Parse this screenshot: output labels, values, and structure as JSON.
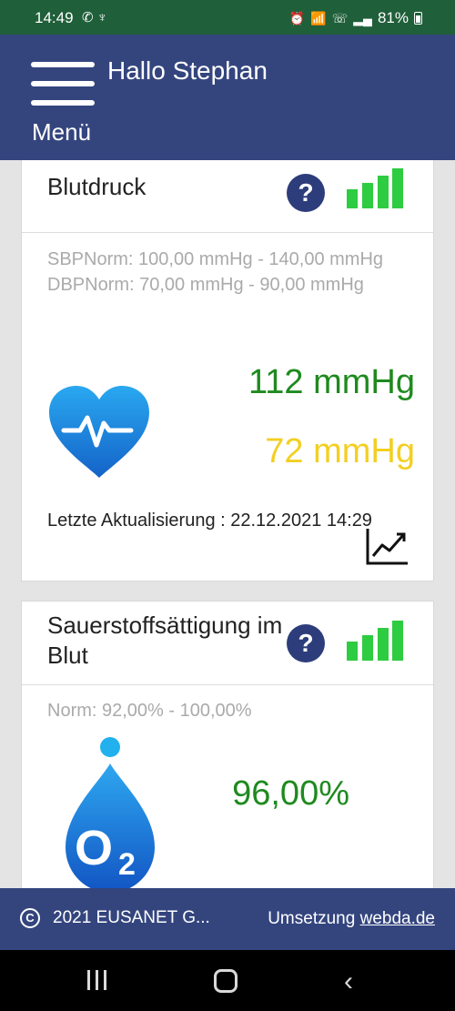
{
  "status_bar": {
    "time": "14:49",
    "left_icons": [
      "whatsapp-icon",
      "app-icon"
    ],
    "right_icons": [
      "alarm-icon",
      "wifi-icon",
      "wifi-call-icon",
      "signal-icon"
    ],
    "battery": "81%"
  },
  "header": {
    "greeting": "Hallo Stephan",
    "menu_label": "Menü"
  },
  "cards": {
    "blood_pressure": {
      "title": "Blutdruck",
      "help_label": "?",
      "norm_line1": "SBPNorm: 100,00 mmHg - 140,00 mmHg",
      "norm_line2": "DBPNorm: 70,00 mmHg - 90,00 mmHg",
      "systolic": "112 mmHg",
      "diastolic": "72 mmHg",
      "updated": "Letzte Aktualisierung : 22.12.2021 14:29",
      "signal_level": 4
    },
    "oxygen": {
      "title": "Sauerstoffsättigung im Blut",
      "help_label": "?",
      "norm": "Norm: 92,00% - 100,00%",
      "value": "96,00%",
      "drop_label": "O",
      "drop_subscript": "2",
      "signal_level": 4
    }
  },
  "footer": {
    "copyright_symbol": "C",
    "copyright_text": "2021 EUSANET G...",
    "implementation_prefix": "Umsetzung",
    "implementation_link": "webda.de"
  },
  "colors": {
    "header_bg": "#34457e",
    "status_bar_bg": "#1f5f3a",
    "help_button": "#2d3d7b",
    "signal_green": "#2ecc40",
    "value_green": "#1e8a1e",
    "value_yellow": "#f3cf22",
    "heart_blue": "#1a8fe0",
    "drop_blue": "#1e73d6"
  }
}
